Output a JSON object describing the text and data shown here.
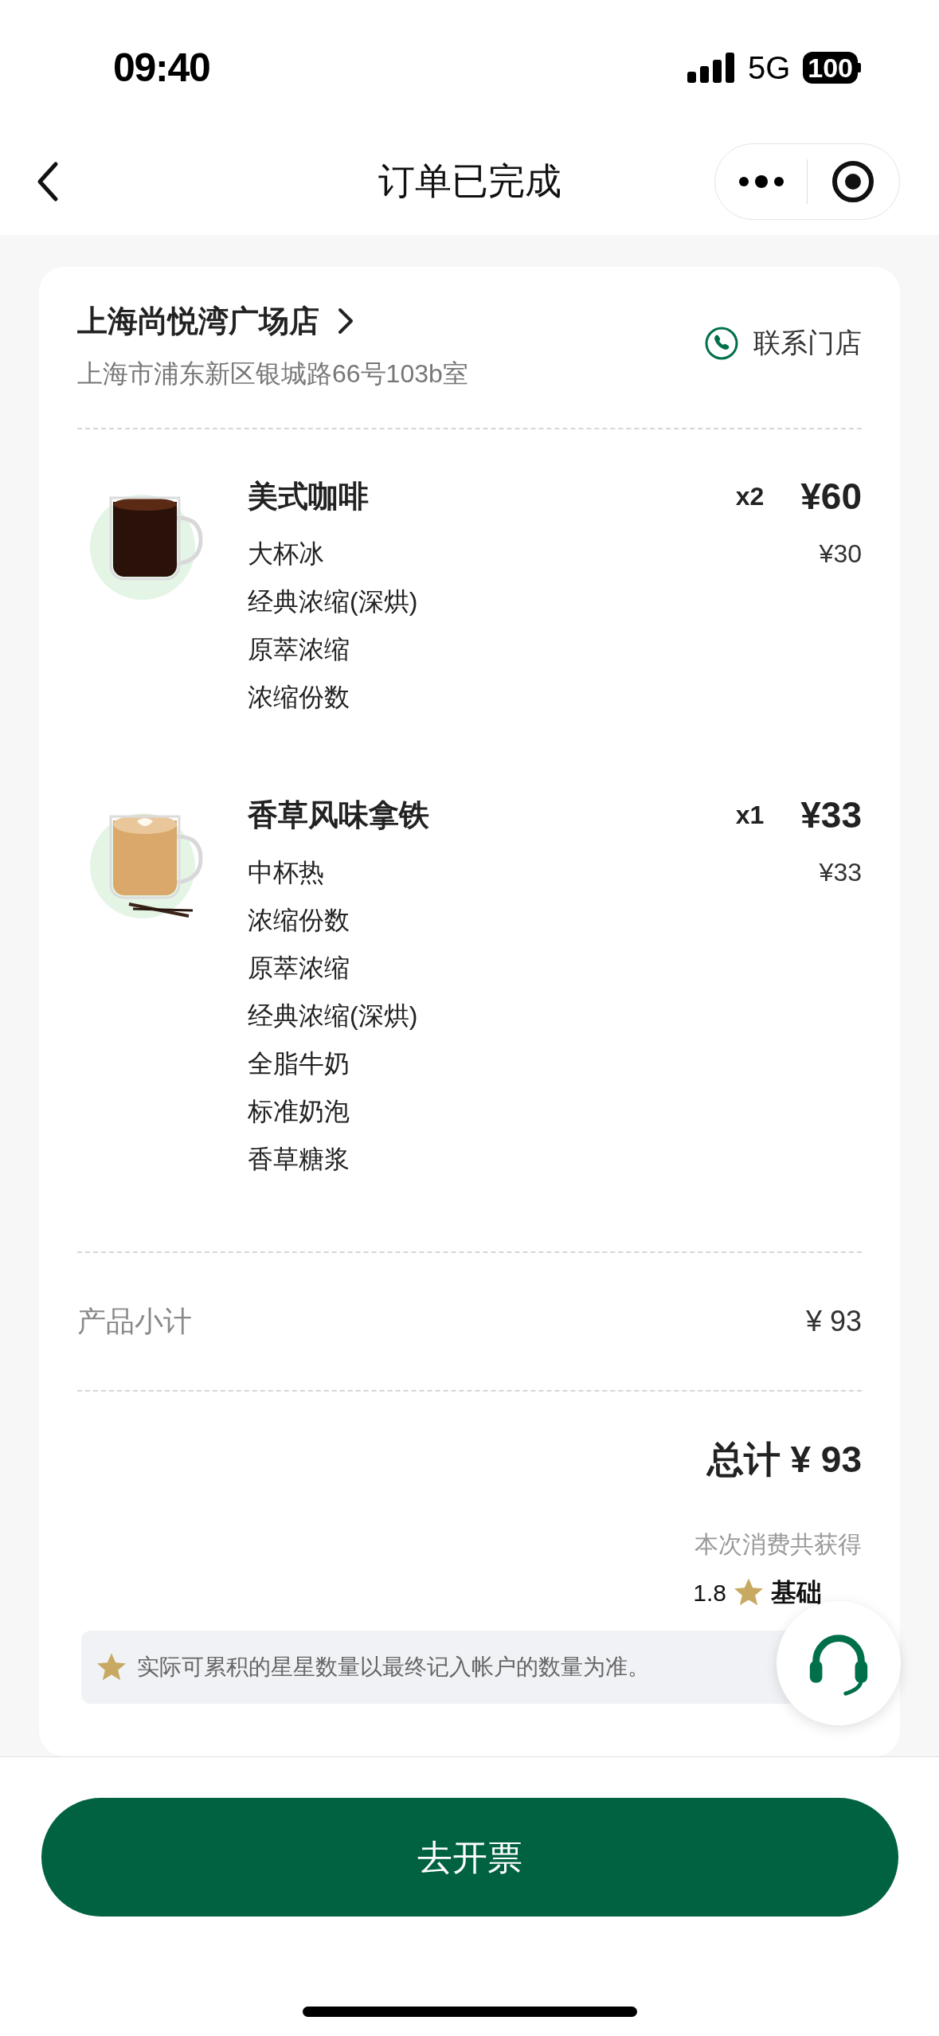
{
  "status_bar": {
    "time": "09:40",
    "network": "5G",
    "battery": "100"
  },
  "nav": {
    "title": "订单已完成"
  },
  "store": {
    "name": "上海尚悦湾广场店",
    "address": "上海市浦东新区银城路66号103b室",
    "contact": "联系门店"
  },
  "items": [
    {
      "name": "美式咖啡",
      "quantity": "x2",
      "total": "¥60",
      "unit_price": "¥30",
      "options": [
        "大杯冰",
        "经典浓缩(深烘)",
        "原萃浓缩",
        "浓缩份数"
      ]
    },
    {
      "name": "香草风味拿铁",
      "quantity": "x1",
      "total": "¥33",
      "unit_price": "¥33",
      "options": [
        "中杯热",
        "浓缩份数",
        "原萃浓缩",
        "经典浓缩(深烘)",
        "全脂牛奶",
        "标准奶泡",
        "香草糖浆"
      ]
    }
  ],
  "subtotal": {
    "label": "产品小计",
    "value": "¥ 93"
  },
  "total": "总计 ¥ 93",
  "rewards": {
    "caption": "本次消费共获得",
    "amount": "1.8",
    "label": "基础"
  },
  "note": "实际可累积的星星数量以最终记入帐户的数量为准。",
  "button": "去开票"
}
